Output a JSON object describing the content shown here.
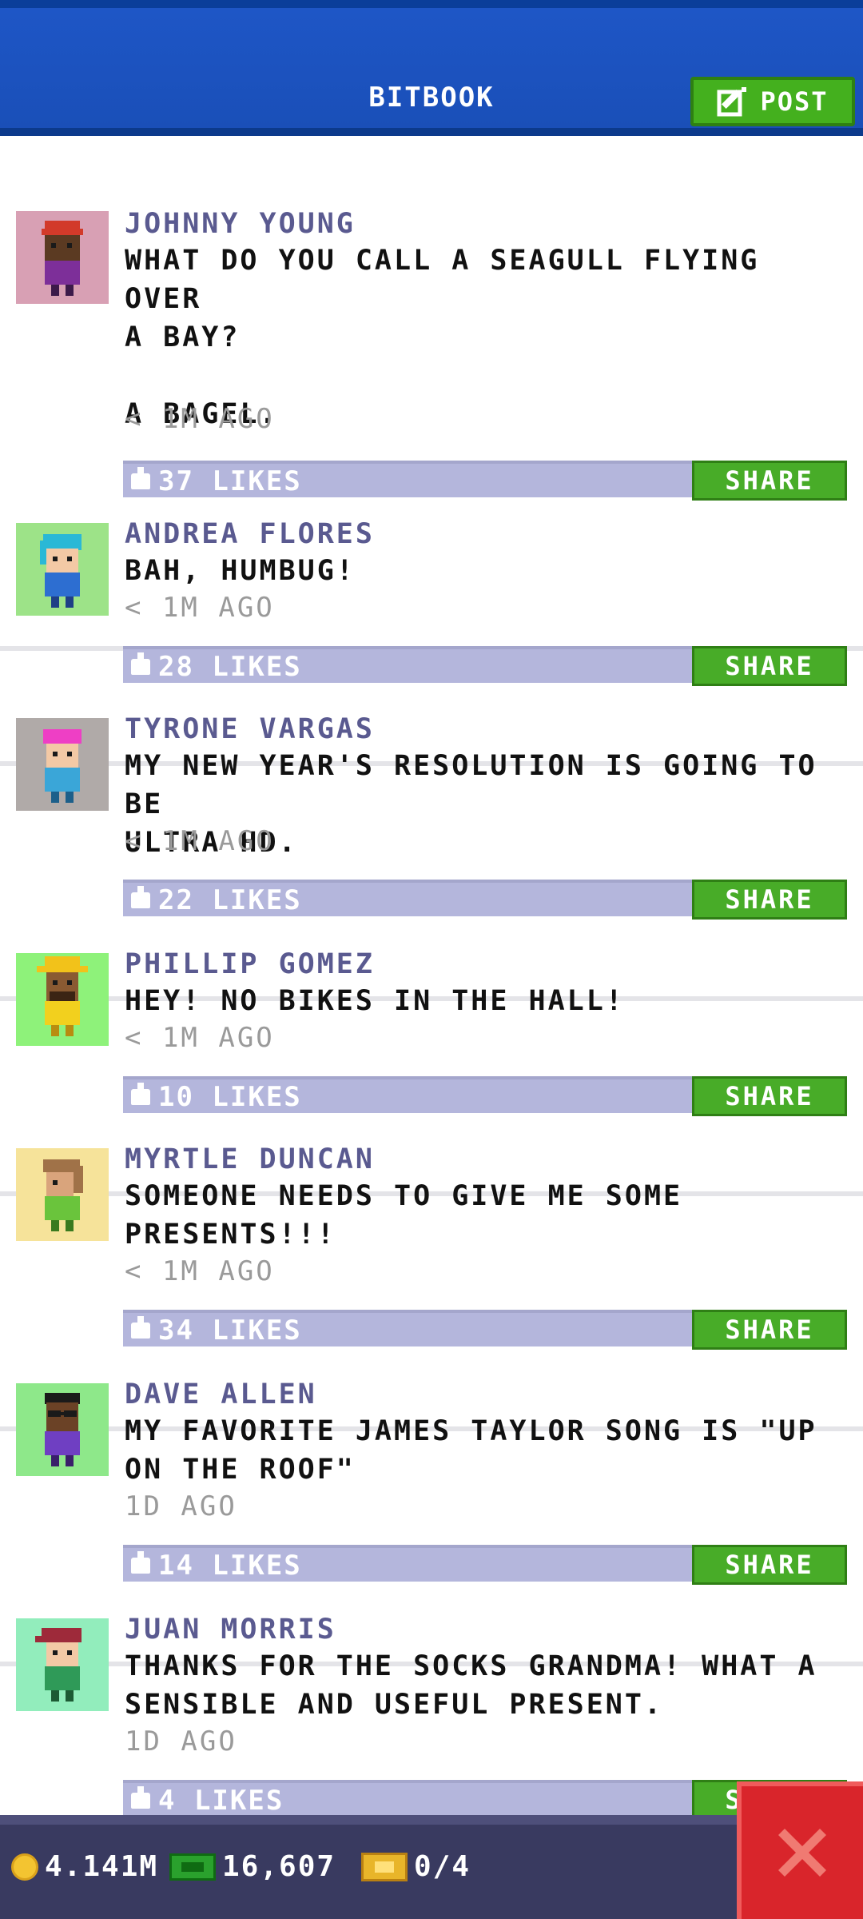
{
  "header": {
    "title": "BITBOOK",
    "post_label": "POST"
  },
  "posts": [
    {
      "author": "JOHNNY YOUNG",
      "message": "WHAT DO YOU CALL A SEAGULL FLYING OVER\nA BAY?\n\nA BAGEL.",
      "time": "< 1M AGO",
      "likes": "37 LIKES",
      "share_label": "SHARE",
      "avatar_bg": "#d8a0b4"
    },
    {
      "author": "ANDREA FLORES",
      "message": "BAH, HUMBUG!",
      "time": "< 1M AGO",
      "likes": "28 LIKES",
      "share_label": "SHARE",
      "avatar_bg": "#9de388"
    },
    {
      "author": "TYRONE VARGAS",
      "message": "MY NEW YEAR'S RESOLUTION IS GOING TO BE\nULTRA HD.",
      "time": "< 1M AGO",
      "likes": "22 LIKES",
      "share_label": "SHARE",
      "avatar_bg": "#b0aaa8"
    },
    {
      "author": "PHILLIP GOMEZ",
      "message": "HEY! NO BIKES IN THE HALL!",
      "time": "< 1M AGO",
      "likes": "10 LIKES",
      "share_label": "SHARE",
      "avatar_bg": "#8ef27a"
    },
    {
      "author": "MYRTLE DUNCAN",
      "message": "SOMEONE NEEDS TO GIVE ME SOME\nPRESENTS!!!",
      "time": "< 1M AGO",
      "likes": "34 LIKES",
      "share_label": "SHARE",
      "avatar_bg": "#f6e39a"
    },
    {
      "author": "DAVE ALLEN",
      "message": "MY FAVORITE JAMES TAYLOR SONG IS \"UP\nON THE ROOF\"",
      "time": "1D AGO",
      "likes": "14 LIKES",
      "share_label": "SHARE",
      "avatar_bg": "#8ee88a"
    },
    {
      "author": "JUAN MORRIS",
      "message": "THANKS FOR THE SOCKS GRANDMA! WHAT A\nSENSIBLE AND USEFUL PRESENT.",
      "time": "1D AGO",
      "likes": "4 LIKES",
      "share_label": "SHARE",
      "avatar_bg": "#92edbc"
    }
  ],
  "status_bar": {
    "coins": "4.141M",
    "cash": "16,607",
    "tickets": "0/4"
  },
  "colors": {
    "header_blue": "#1e56c6",
    "share_green": "#48ac28",
    "close_red": "#d9252b",
    "author_purple": "#5a5a90"
  }
}
